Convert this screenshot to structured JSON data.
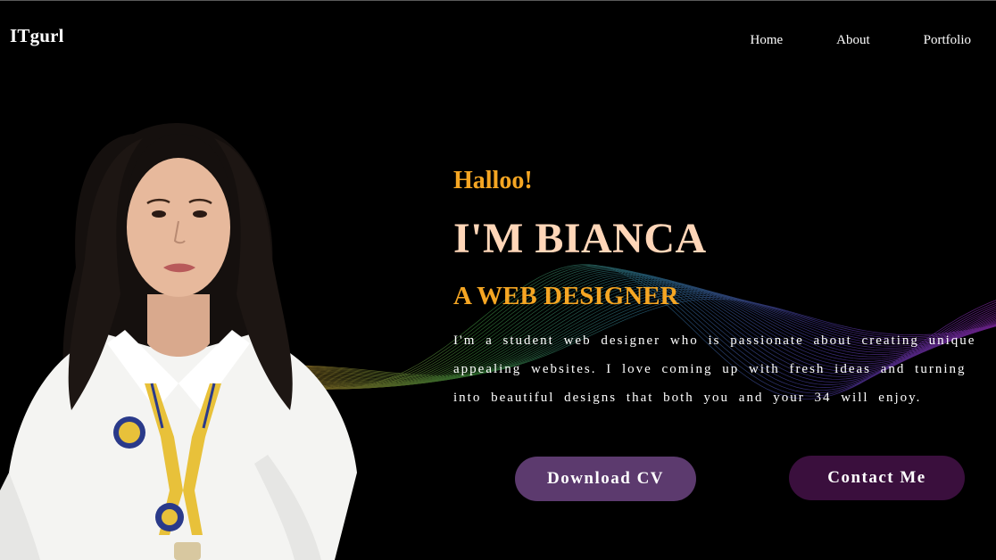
{
  "header": {
    "logo": "ITgurl",
    "nav": [
      "Home",
      "About",
      "Portfolio"
    ]
  },
  "hero": {
    "greeting": "Halloo!",
    "name": "I'M BIANCA",
    "role": "A WEB DESIGNER",
    "description_lines": [
      "I'm a student web designer who is passionate about creating unique",
      "appealing websites. I love coming up with fresh ideas and turning",
      "into beautiful designs that both you and your 34 will enjoy."
    ],
    "buttons": {
      "download": "Download CV",
      "contact": "Contact Me"
    }
  },
  "colors": {
    "background": "#000000",
    "accent": "#f5a623",
    "name": "#ffd6b8",
    "btn_download": "#5c3a6e",
    "btn_contact": "#3a0f3d"
  },
  "images": {
    "portrait": "profile-photo"
  }
}
